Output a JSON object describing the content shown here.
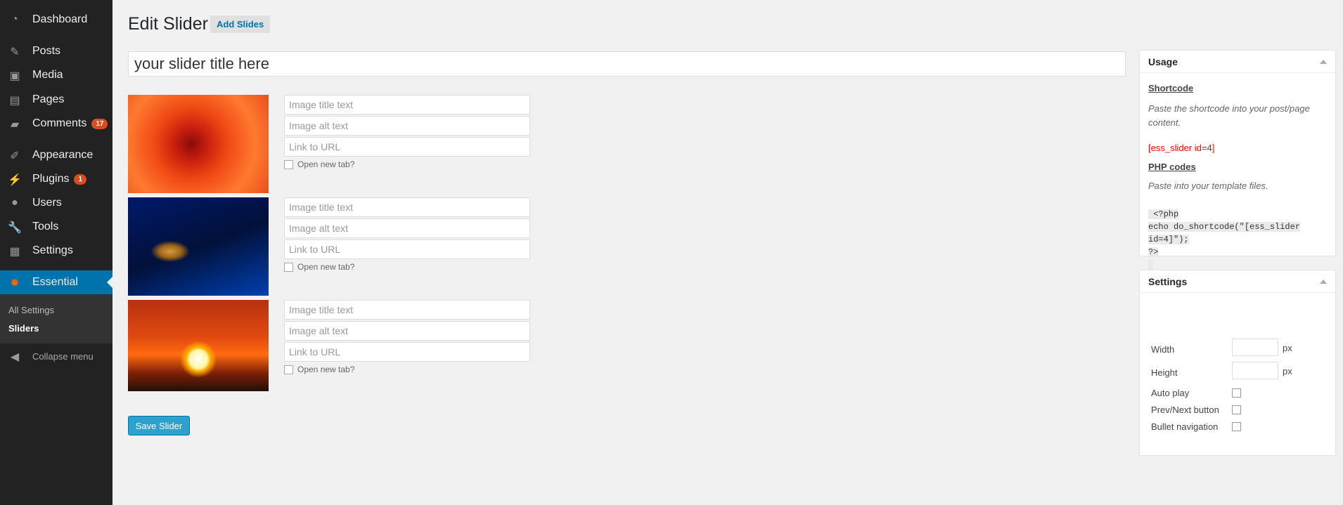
{
  "sidebar": {
    "items": [
      {
        "label": "Dashboard",
        "icon": "dashboard-icon"
      },
      {
        "label": "Posts",
        "icon": "pin-icon"
      },
      {
        "label": "Media",
        "icon": "media-icon"
      },
      {
        "label": "Pages",
        "icon": "pages-icon"
      },
      {
        "label": "Comments",
        "icon": "comment-icon",
        "badge": "17"
      },
      {
        "label": "Appearance",
        "icon": "brush-icon"
      },
      {
        "label": "Plugins",
        "icon": "plugin-icon",
        "badge": "1"
      },
      {
        "label": "Users",
        "icon": "user-icon"
      },
      {
        "label": "Tools",
        "icon": "wrench-icon"
      },
      {
        "label": "Settings",
        "icon": "settings-icon"
      },
      {
        "label": "Essential",
        "icon": "gear-icon",
        "active": true
      }
    ],
    "submenu": [
      "All Settings",
      "Sliders"
    ],
    "collapse": "Collapse menu"
  },
  "header": {
    "title": "Edit Slider",
    "add_slides": "Add Slides"
  },
  "slider_title": "your slider title here",
  "slides": {
    "placeholders": {
      "title": "Image title text",
      "alt": "Image alt text",
      "url": "Link to URL"
    },
    "new_tab": "Open new tab?"
  },
  "save_label": "Save Slider",
  "usage": {
    "title": "Usage",
    "shortcode_h": "Shortcode",
    "shortcode_desc": "Paste the shortcode into your post/page content.",
    "shortcode": "[ess_slider id=4]",
    "php_h": "PHP codes",
    "php_desc": "Paste into your template files.",
    "php_lines": [
      " <?php",
      "echo do_shortcode(\"[ess_slider",
      "id=4]\");",
      "?>"
    ]
  },
  "settings": {
    "title": "Settings",
    "width": "Width",
    "height": "Height",
    "unit": "px",
    "autoplay": "Auto play",
    "prevnext": "Prev/Next button",
    "bullet": "Bullet navigation"
  },
  "colors": {
    "accent": "#0073aa",
    "badge": "#d54e21",
    "shortcode": "#ff0000"
  }
}
